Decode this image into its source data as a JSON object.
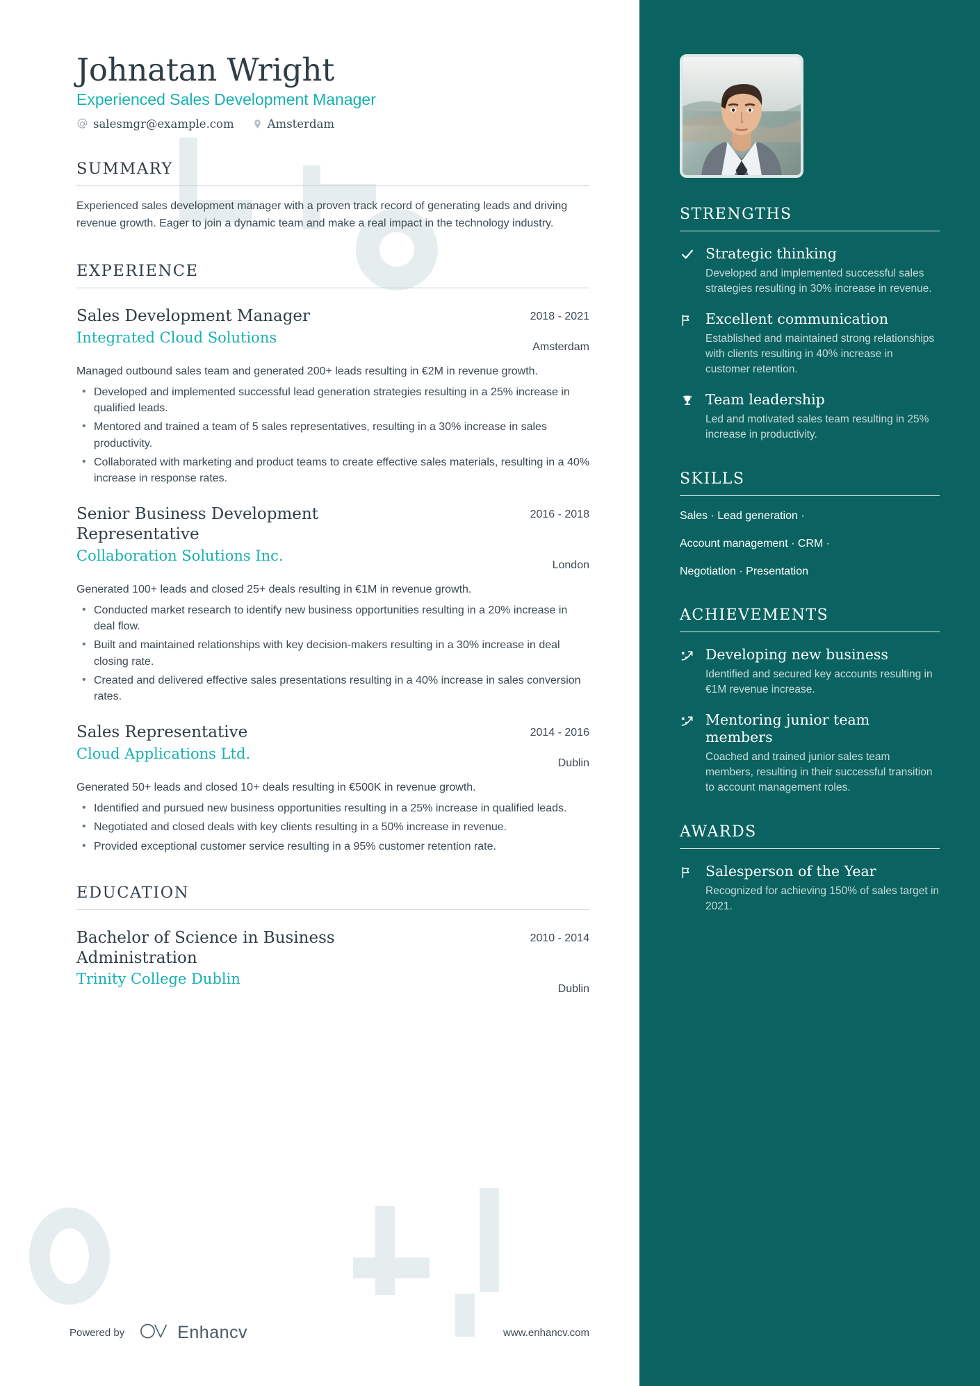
{
  "header": {
    "name": "Johnatan Wright",
    "headline": "Experienced Sales Development Manager",
    "email": "salesmgr@example.com",
    "location": "Amsterdam"
  },
  "summary": {
    "title": "SUMMARY",
    "text": "Experienced sales development manager with a proven track record of generating leads and driving revenue growth. Eager to join a dynamic team and make a real impact in the technology industry."
  },
  "experience": {
    "title": "EXPERIENCE",
    "entries": [
      {
        "job_title": "Sales Development Manager",
        "company": "Integrated Cloud Solutions",
        "dates": "2018 - 2021",
        "location": "Amsterdam",
        "description": "Managed outbound sales team and generated 200+ leads resulting in €2M in revenue growth.",
        "bullets": [
          "Developed and implemented successful lead generation strategies resulting in a 25% increase in qualified leads.",
          "Mentored and trained a team of 5 sales representatives, resulting in a 30% increase in sales productivity.",
          "Collaborated with marketing and product teams to create effective sales materials, resulting in a 40% increase in response rates."
        ]
      },
      {
        "job_title": "Senior Business Development Representative",
        "company": "Collaboration Solutions Inc.",
        "dates": "2016 - 2018",
        "location": "London",
        "description": "Generated 100+ leads and closed 25+ deals resulting in €1M in revenue growth.",
        "bullets": [
          "Conducted market research to identify new business opportunities resulting in a 20% increase in deal flow.",
          "Built and maintained relationships with key decision-makers resulting in a 30% increase in deal closing rate.",
          "Created and delivered effective sales presentations resulting in a 40% increase in sales conversion rates."
        ]
      },
      {
        "job_title": "Sales Representative",
        "company": "Cloud Applications Ltd.",
        "dates": "2014 - 2016",
        "location": "Dublin",
        "description": "Generated 50+ leads and closed 10+ deals resulting in €500K in revenue growth.",
        "bullets": [
          "Identified and pursued new business opportunities resulting in a 25% increase in qualified leads.",
          "Negotiated and closed deals with key clients resulting in a 50% increase in revenue.",
          "Provided exceptional customer service resulting in a 95% customer retention rate."
        ]
      }
    ]
  },
  "education": {
    "title": "EDUCATION",
    "entries": [
      {
        "degree": "Bachelor of Science in Business Administration",
        "school": "Trinity College Dublin",
        "dates": "2010 - 2014",
        "location": "Dublin"
      }
    ]
  },
  "strengths": {
    "title": "STRENGTHS",
    "items": [
      {
        "icon": "check-icon",
        "title": "Strategic thinking",
        "desc": "Developed and implemented successful sales strategies resulting in 30% increase in revenue."
      },
      {
        "icon": "flag-icon",
        "title": "Excellent communication",
        "desc": "Established and maintained strong relationships with clients resulting in 40% increase in customer retention."
      },
      {
        "icon": "trophy-icon",
        "title": "Team leadership",
        "desc": "Led and motivated sales team resulting in 25% increase in productivity."
      }
    ]
  },
  "skills": {
    "title": "SKILLS",
    "lines": [
      "Sales · Lead generation ·",
      "Account management · CRM ·",
      "Negotiation · Presentation"
    ]
  },
  "achievements": {
    "title": "ACHIEVEMENTS",
    "items": [
      {
        "icon": "rocket-icon",
        "title": "Developing new business",
        "desc": "Identified and secured key accounts resulting in €1M revenue increase."
      },
      {
        "icon": "rocket-icon",
        "title": "Mentoring junior team members",
        "desc": "Coached and trained junior sales team members, resulting in their successful transition to account management roles."
      }
    ]
  },
  "awards": {
    "title": "AWARDS",
    "items": [
      {
        "icon": "flag-icon",
        "title": "Salesperson of the Year",
        "desc": "Recognized for achieving 150% of sales target in 2021."
      }
    ]
  },
  "footer": {
    "powered_by": "Powered by",
    "brand": "Enhancv",
    "website": "www.enhancv.com"
  },
  "colors": {
    "accent_teal": "#18b0b0",
    "sidebar_bg": "#0a6361",
    "ink": "#2f3e46",
    "deco": "#e6edee"
  }
}
